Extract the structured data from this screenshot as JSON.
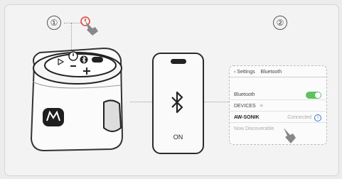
{
  "steps": {
    "one": "①",
    "two": "②"
  },
  "phone": {
    "status": "ON"
  },
  "settings": {
    "back_label": "Settings",
    "title": "Bluetooth",
    "bluetooth_label": "Bluetooth",
    "bluetooth_on": true,
    "devices_label": "DEVICES",
    "device_name": "AW-SONIK",
    "device_status": "Connected",
    "discoverable_text": "Now Discoverable"
  },
  "colors": {
    "toggle_on": "#5ec25e",
    "info": "#3b72d9",
    "power_ring": "#e0453a"
  },
  "icons": [
    "power-icon",
    "bluetooth-icon",
    "play-icon",
    "minus-icon",
    "plus-icon",
    "hand-pointer-icon",
    "info-icon",
    "spinner-icon",
    "chevron-left-icon"
  ]
}
